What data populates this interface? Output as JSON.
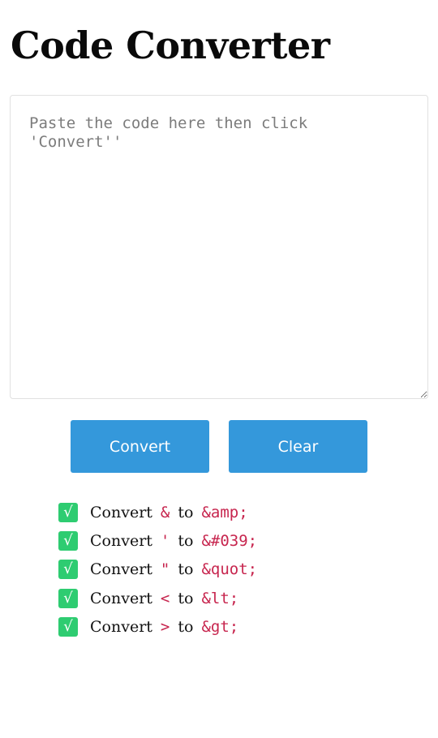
{
  "page": {
    "title": "Code Converter"
  },
  "editor": {
    "placeholder": "Paste the code here then click 'Convert''",
    "value": ""
  },
  "buttons": {
    "convert_label": "Convert",
    "clear_label": "Clear"
  },
  "rules": [
    {
      "word": "Convert",
      "from": "&",
      "to_word": "to",
      "to": "&amp;"
    },
    {
      "word": "Convert",
      "from": "'",
      "to_word": "to",
      "to": "&#039;"
    },
    {
      "word": "Convert",
      "from": "\"",
      "to_word": "to",
      "to": "&quot;"
    },
    {
      "word": "Convert",
      "from": "<",
      "to_word": "to",
      "to": "&lt;"
    },
    {
      "word": "Convert",
      "from": ">",
      "to_word": "to",
      "to": "&gt;"
    }
  ],
  "check_glyph": "√",
  "colors": {
    "button": "#3498db",
    "check": "#2ecc71",
    "code": "#c7254e"
  }
}
